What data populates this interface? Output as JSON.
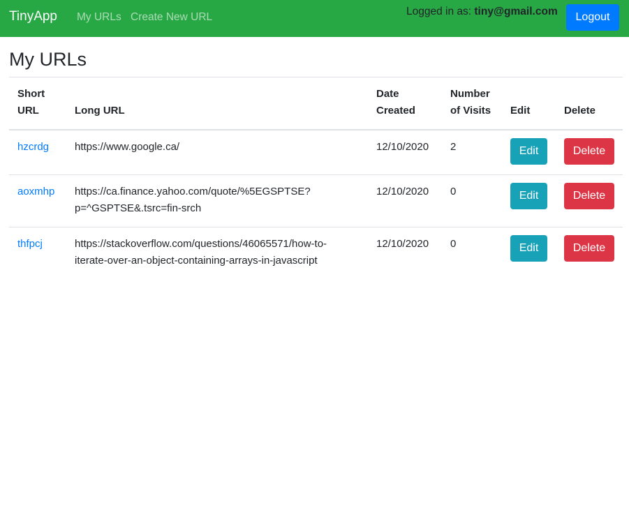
{
  "navbar": {
    "brand": "TinyApp",
    "links": [
      "My URLs",
      "Create New URL"
    ],
    "login_prefix": "Logged in as: ",
    "user_email": "tiny@gmail.com",
    "logout_label": "Logout",
    "color": "#28a745"
  },
  "main": {
    "title": "My URLs",
    "columns": [
      "Short URL",
      "Long URL",
      "Date Created",
      "Number of Visits",
      "Edit",
      "Delete"
    ],
    "header_lines": [
      [
        "Short",
        "URL"
      ],
      [
        "Long URL"
      ],
      [
        "Date",
        "Created"
      ],
      [
        "Number",
        "of Visits"
      ],
      [
        "Edit"
      ],
      [
        "Delete"
      ]
    ],
    "rows": [
      {
        "short": "hzcrdg",
        "long_lines": [
          "https://www.google.ca/"
        ],
        "date": "12/10/2020",
        "visits": "2",
        "edit": "Edit",
        "delete": "Delete"
      },
      {
        "short": "aoxmhp",
        "long_lines": [
          "https://ca.finance.yahoo.com/quote/%5EGSPTSE?",
          "p=^GSPTSE&.tsrc=fin-srch"
        ],
        "date": "12/10/2020",
        "visits": "0",
        "edit": "Edit",
        "delete": "Delete"
      },
      {
        "short": "thfpcj",
        "long_lines": [
          "https://stackoverflow.com/questions/46065571/how-to-",
          "iterate-over-an-object-containing-arrays-in-javascript"
        ],
        "date": "12/10/2020",
        "visits": "0",
        "edit": "Edit",
        "delete": "Delete"
      }
    ],
    "colors": {
      "link": "#007bff",
      "edit": "#17a2b8",
      "delete": "#dc3545",
      "logout": "#007bff"
    }
  }
}
